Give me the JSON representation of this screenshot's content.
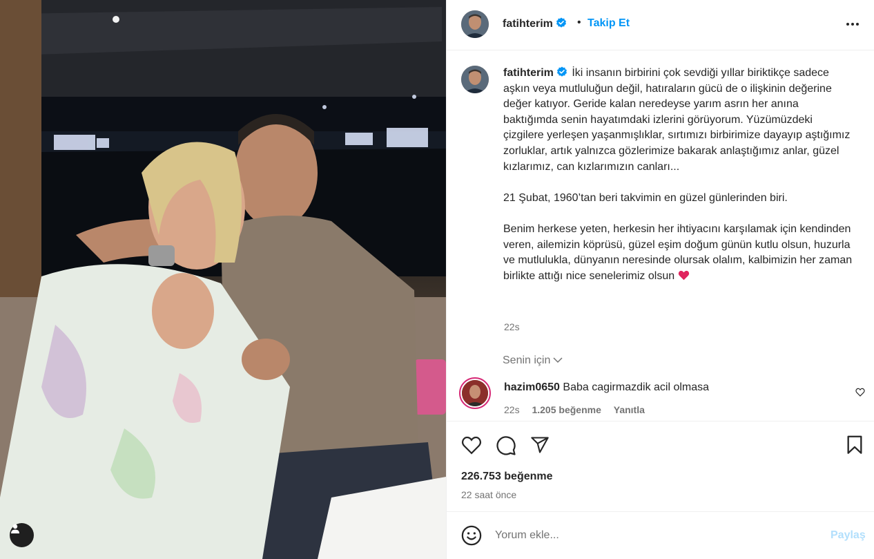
{
  "post": {
    "author": "fatihterim",
    "follow_label": "Takip Et",
    "separator": "•",
    "caption": {
      "paragraph1": "İki insanın birbirini çok sevdiği yıllar biriktikçe sadece aşkın veya mutluluğun değil, hatıraların gücü de o ilişkinin değerine değer katıyor. Geride kalan neredeyse yarım asrın her anına baktığımda senin hayatımdaki izlerini görüyorum. Yüzümüzdeki çizgilere yerleşen yaşanmışlıklar, sırtımızı birbirimize dayayıp aştığımız zorluklar, artık yalnızca gözlerimize bakarak anlaştığımız anlar, güzel kızlarımız, can kızlarımızın canları...",
      "paragraph2": "21 Şubat, 1960’tan beri takvimin en güzel günlerinden biri.",
      "paragraph3": "Benim herkese yeten, herkesin her ihtiyacını karşılamak için kendinden veren, ailemizin köprüsü, güzel eşim doğum günün kutlu olsun, huzurla ve mutlulukla, dünyanın neresinde olursak olalım, kalbimizin her zaman birlikte attığı nice senelerimiz olsun",
      "emoji": "red-heart-emoji",
      "time": "22s"
    },
    "for_you_label": "Senin için",
    "comment": {
      "username": "hazim0650",
      "text": "Baba cagirmazdik acil olmasa",
      "time": "22s",
      "likes": "1.205 beğenme",
      "reply_label": "Yanıtla"
    },
    "likes_count": "226.753 beğenme",
    "time_ago": "22 saat önce",
    "add_comment": {
      "placeholder": "Yorum ekle...",
      "post_label": "Paylaş"
    }
  },
  "colors": {
    "link_blue": "#0095f6",
    "verified_blue": "#0095f6",
    "muted_text": "#737373",
    "border": "#efefef",
    "post_disabled": "#b2dffc"
  },
  "icons": [
    "verified-badge-icon",
    "more-options-icon",
    "chevron-down-icon",
    "heart-outline-icon",
    "comment-icon",
    "share-icon",
    "bookmark-icon",
    "emoji-smiley-icon",
    "user-tag-icon"
  ]
}
